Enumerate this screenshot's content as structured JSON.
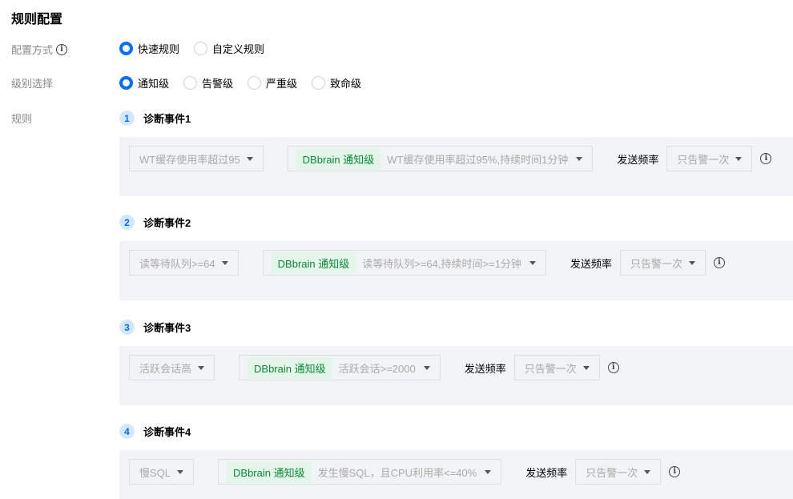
{
  "page": {
    "title": "规则配置"
  },
  "config_mode": {
    "label": "配置方式",
    "options": [
      {
        "label": "快速规则",
        "checked": true
      },
      {
        "label": "自定义规则",
        "checked": false
      }
    ]
  },
  "level_select": {
    "label": "级别选择",
    "options": [
      {
        "label": "通知级",
        "checked": true
      },
      {
        "label": "告警级",
        "checked": false
      },
      {
        "label": "严重级",
        "checked": false
      },
      {
        "label": "致命级",
        "checked": false
      }
    ]
  },
  "rules": {
    "label": "规则",
    "events": [
      {
        "num": "1",
        "title": "诊断事件1",
        "metric": "WT缓存使用率超过95",
        "badge": "DBbrain 通知级",
        "desc": "WT缓存使用率超过95%,持续时间1分钟",
        "freq_label": "发送频率",
        "freq_value": "只告警一次"
      },
      {
        "num": "2",
        "title": "诊断事件2",
        "metric": "读等待队列>=64",
        "badge": "DBbrain 通知级",
        "desc": "读等待队列>=64,持续时间>=1分钟",
        "freq_label": "发送频率",
        "freq_value": "只告警一次"
      },
      {
        "num": "3",
        "title": "诊断事件3",
        "metric": "活跃会话高",
        "badge": "DBbrain 通知级",
        "desc": "活跃会话>=2000",
        "freq_label": "发送频率",
        "freq_value": "只告警一次"
      },
      {
        "num": "4",
        "title": "诊断事件4",
        "metric": "慢SQL",
        "badge": "DBbrain 通知级",
        "desc": "发生慢SQL，且CPU利用率<=40%",
        "freq_label": "发送频率",
        "freq_value": "只告警一次"
      }
    ]
  },
  "colors": {
    "accent": "#006eff",
    "badge_bg": "#e4f5ea",
    "badge_text": "#0a8a3a",
    "panel_bg": "#f2f4f7"
  }
}
